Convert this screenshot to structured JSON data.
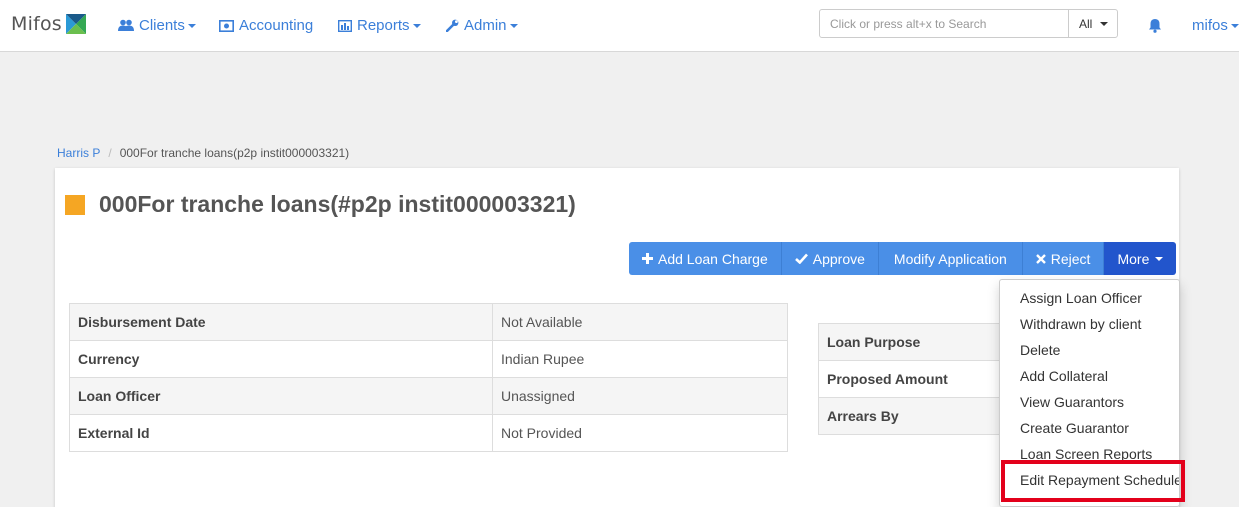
{
  "brand": {
    "name": "Mifos",
    "logo_icon": "mifos-x-logo-icon"
  },
  "nav": [
    {
      "label": "Clients",
      "icon": "users-icon",
      "dropdown": true
    },
    {
      "label": "Accounting",
      "icon": "money-icon",
      "dropdown": false
    },
    {
      "label": "Reports",
      "icon": "bar-chart-icon",
      "dropdown": true
    },
    {
      "label": "Admin",
      "icon": "wrench-icon",
      "dropdown": true
    }
  ],
  "search": {
    "placeholder": "Click or press alt+x to Search",
    "scope": "All"
  },
  "user": {
    "name": "mifos"
  },
  "breadcrumb": {
    "parent": "Harris P",
    "current": "000For tranche loans(p2p instit000003321)"
  },
  "loan": {
    "title": "000For tranche loans(#p2p instit000003321)",
    "status_color": "#f5a623"
  },
  "actions": {
    "add_charge": "Add Loan Charge",
    "approve": "Approve",
    "modify": "Modify Application",
    "reject": "Reject",
    "more": "More"
  },
  "details_left": [
    {
      "key": "Disbursement Date",
      "value": "Not Available"
    },
    {
      "key": "Currency",
      "value": "Indian Rupee"
    },
    {
      "key": "Loan Officer",
      "value": "Unassigned"
    },
    {
      "key": "External Id",
      "value": "Not Provided"
    }
  ],
  "details_right": [
    {
      "key": "Loan Purpose"
    },
    {
      "key": "Proposed Amount"
    },
    {
      "key": "Arrears By"
    }
  ],
  "more_menu": [
    "Assign Loan Officer",
    "Withdrawn by client",
    "Delete",
    "Add Collateral",
    "View Guarantors",
    "Create Guarantor",
    "Loan Screen Reports",
    "Edit Repayment Schedule"
  ],
  "colors": {
    "link": "#3b7fd9",
    "primary_button": "#4a8fe7",
    "more_button": "#2255cc",
    "highlight": "#e3001b"
  }
}
